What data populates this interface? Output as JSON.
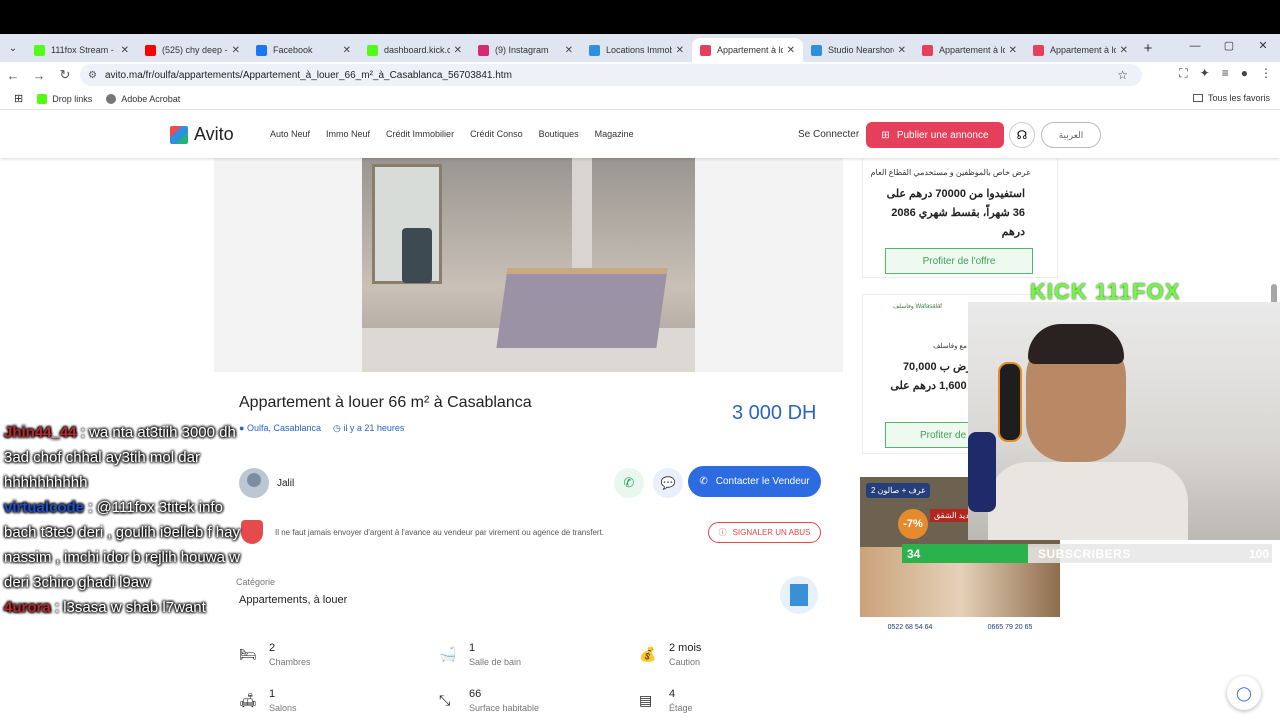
{
  "browser": {
    "tabs": [
      {
        "title": "111fox Stream - K",
        "color": "#53fc18"
      },
      {
        "title": "(525) chy deep - Y",
        "color": "#ff0000"
      },
      {
        "title": "Facebook",
        "color": "#1877f2"
      },
      {
        "title": "dashboard.kick.co",
        "color": "#53fc18"
      },
      {
        "title": "(9) Instagram",
        "color": "#d62976"
      },
      {
        "title": "Locations Immob",
        "color": "#2f8ee0"
      },
      {
        "title": "Appartement à lo",
        "color": "#e4405b"
      },
      {
        "title": "Studio Nearshore",
        "color": "#2f8ee0"
      },
      {
        "title": "Appartement à lo",
        "color": "#e4405b"
      },
      {
        "title": "Appartement à lo",
        "color": "#e4405b"
      }
    ],
    "url": "avito.ma/fr/oulfa/appartements/Appartement_à_louer_66_m²_à_Casablanca_56703841.htm",
    "bookmarks": [
      "Drop links",
      "Adobe Acrobat"
    ],
    "all_bookmarks": "Tous les favoris"
  },
  "header": {
    "logo": "Avito",
    "nav": [
      "Auto Neuf",
      "Immo Neuf",
      "Crédit Immobilier",
      "Crédit Conso",
      "Boutiques",
      "Magazine"
    ],
    "connect": "Se Connecter",
    "publish": "Publier une annonce",
    "lang": "العربية"
  },
  "listing": {
    "title": "Appartement à louer 66 m² à Casablanca",
    "price": "3 000 DH",
    "location": "Oulfa, Casablanca",
    "time": "il y a 21 heures",
    "seller": "Jalil",
    "contact": "Contacter le Vendeur",
    "warning": "Il ne faut jamais envoyer d'argent à l'avance au vendeur par virement ou agence de transfert.",
    "report": "SIGNALER UN ABUS",
    "category_label": "Catégorie",
    "category": "Appartements, à louer",
    "features": [
      {
        "value": "2",
        "label": "Chambres",
        "icon": "bed-icon",
        "glyph": "🛏"
      },
      {
        "value": "1",
        "label": "Salle de bain",
        "icon": "bath-icon",
        "glyph": "🛁"
      },
      {
        "value": "2 mois",
        "label": "Caution",
        "icon": "deposit-icon",
        "glyph": "💰"
      },
      {
        "value": "1",
        "label": "Salons",
        "icon": "sofa-icon",
        "glyph": "🛋"
      },
      {
        "value": "66",
        "label": "Surface habitable",
        "icon": "area-icon",
        "glyph": "⤡"
      },
      {
        "value": "4",
        "label": "Étage",
        "icon": "floor-icon",
        "glyph": "▤"
      }
    ]
  },
  "ads": {
    "ad1_small": "عرض خاص بالموظفين و مستخدمي القطاع العام",
    "ad1_big": "استفيدوا من 70000 درهم على 36 شهراً، بقسط شهري 2086 درهم",
    "ad1_button": "Profiter de l'offre",
    "ad2_logo": "وفاسلف Wafasalaf",
    "ad2_small": "تحقق أحلامك أسهل مع وفاسلف",
    "ad2_big": "استفد من قرض ب 70,000 درهم بقسط 1,600 درهم على 52 شهر",
    "ad2_button": "Profiter de",
    "ad3_badge": "2 غرف + صالون",
    "ad3_discount": "-7%",
    "ad3_promo": "من جديد الشقق",
    "ad3_phone1": "0522 68 54 64",
    "ad3_phone2": "0665 79 20 65"
  },
  "overlay": {
    "kick_label": "KICK 111FOX",
    "subs_current": "34",
    "subs_label": "SUBSCRIBERS",
    "subs_goal": "100",
    "subs_progress": 0.34,
    "chat": [
      {
        "user": "Jhin44_44",
        "color": "#c0262b",
        "msg": ": wa nta at3tiih 3000 dh 3ad chof chhal ay3tih mol dar hhhhhhhhhh"
      },
      {
        "user": "virtualcode",
        "color": "#1e4fd0",
        "msg": ": @111fox 3titek info bach t3te9 deri , goulih i9elleb f hay nassim , imchi idor b rejlih houwa w deri 3chiro ghadi l9aw"
      },
      {
        "user": "4urora",
        "color": "#c0262b",
        "msg": ": l3sasa w shab l7want"
      }
    ]
  }
}
